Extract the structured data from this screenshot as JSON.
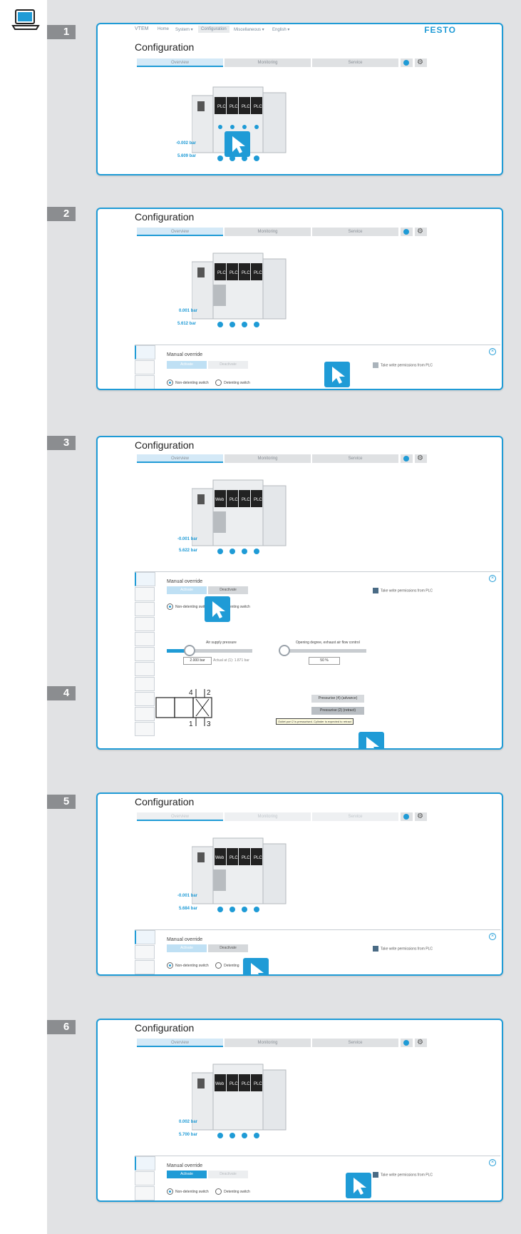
{
  "steps": [
    "1",
    "2",
    "3",
    "4",
    "5",
    "6"
  ],
  "app": {
    "nav": {
      "brand": "VTEM",
      "home": "Home",
      "system": "System ▾",
      "configuration": "Configuration",
      "misc": "Miscellaneous ▾",
      "lang": "English ▾",
      "logo": "FESTO"
    },
    "title": "Configuration",
    "tabs": [
      "Overview",
      "Monitoring",
      "Service"
    ]
  },
  "valves": {
    "web": "Web",
    "plc": "PLC",
    "festo": "FESTO"
  },
  "panels": [
    {
      "pressure_top": "-0.002 bar",
      "pressure_bottom": "5.609 bar"
    },
    {
      "pressure_top": "0.001 bar",
      "pressure_bottom": "5.612 bar"
    },
    {
      "pressure_top": "-0.001 bar",
      "pressure_bottom": "5.622 bar"
    },
    {
      "pressure_top": "-0.001 bar",
      "pressure_bottom": "5.684 bar"
    },
    {
      "pressure_top": "0.002 bar",
      "pressure_bottom": "5.700 bar"
    }
  ],
  "manual": {
    "title": "Manual override",
    "activate": "Activate",
    "deactivate": "Deactivate",
    "non_detenting": "Non-detenting switch",
    "detenting": "Detenting switch",
    "detenting_partial": "Detenting",
    "plc_perm": "Take write permissions from PLC"
  },
  "controls": {
    "air_supply_label": "Air supply pressure",
    "air_supply_value": "2.000 bar",
    "air_supply_actual": "Actual at (1): 1.871 bar",
    "opening_label": "Opening degree, exhaust air flow control",
    "opening_value": "50 %",
    "press_advance": "Pressurise (4) (advance)",
    "press_retract": "Pressurise (2) (retract)",
    "hint": "Outlet port 2 is pressurised. Cylinder is expected to retract",
    "symbol_ports": [
      "4",
      "2",
      "1",
      "3"
    ]
  },
  "air_supply_level": 0.25,
  "opening_level": 0.0,
  "colors": {
    "accent": "#1f9bd6",
    "strip": "#e1e2e4",
    "step": "#8b8d90"
  }
}
